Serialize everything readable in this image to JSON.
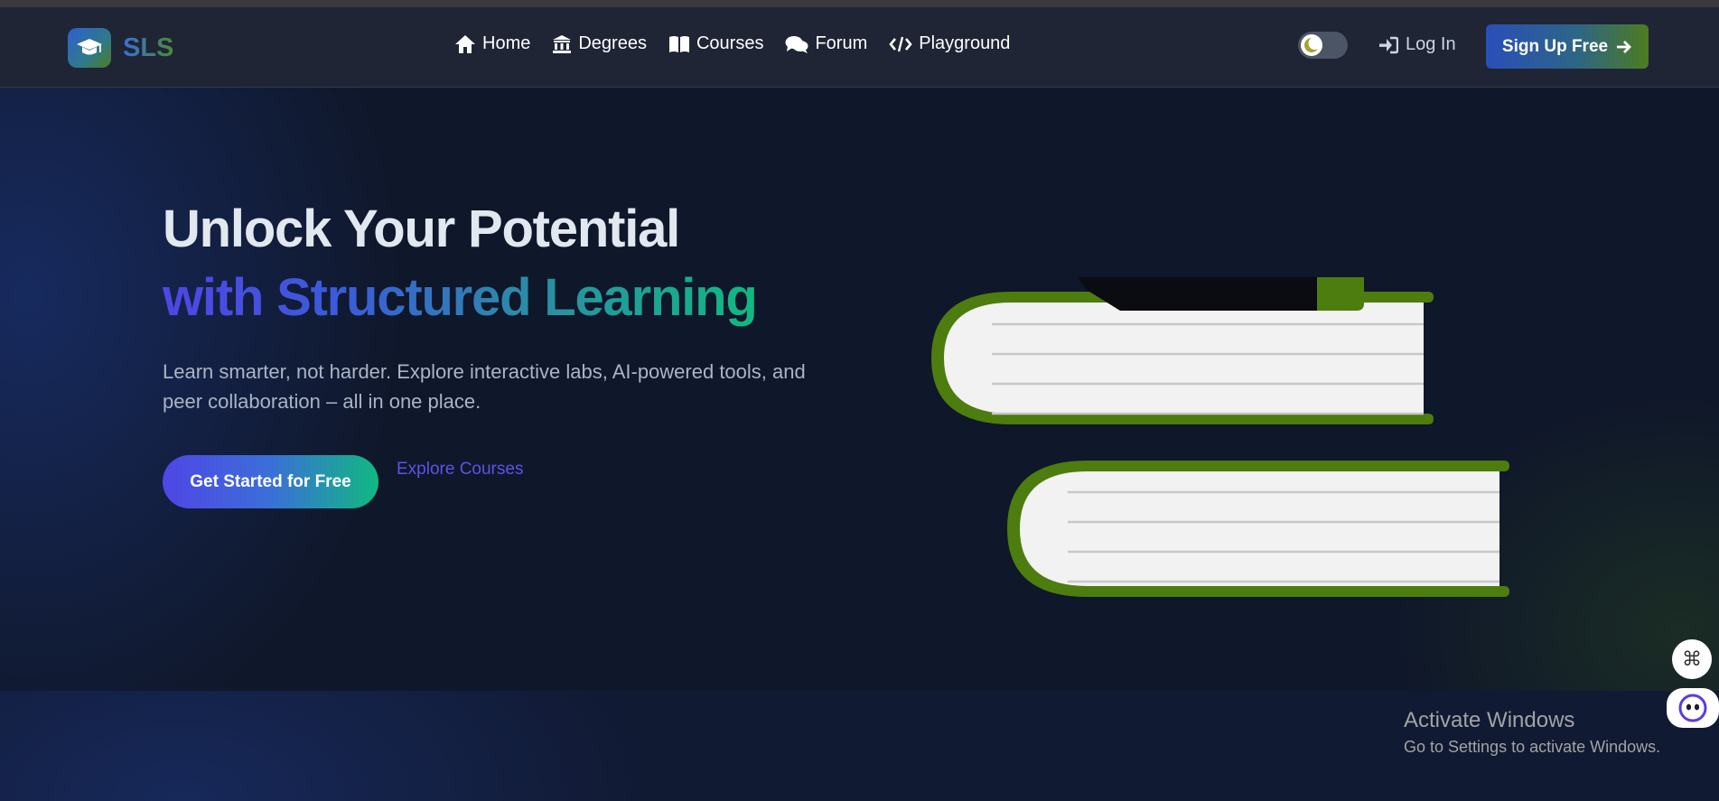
{
  "navbar": {
    "logo_text": "SLS",
    "links": [
      {
        "label": "Home",
        "icon": "home-icon"
      },
      {
        "label": "Degrees",
        "icon": "university-icon"
      },
      {
        "label": "Courses",
        "icon": "book-open-icon"
      },
      {
        "label": "Forum",
        "icon": "comments-icon"
      },
      {
        "label": "Playground",
        "icon": "code-icon"
      }
    ],
    "theme_toggle_icon": "moon-icon",
    "login_label": "Log In",
    "signup_label": "Sign Up Free"
  },
  "hero": {
    "title_line1": "Unlock Your Potential",
    "title_line2": "with Structured Learning",
    "description": "Learn smarter, not harder. Explore interactive labs, AI-powered tools, and peer collaboration – all in one place.",
    "cta_label": "Get Started for Free",
    "explore_label": "Explore Courses",
    "illustration": "stacked-books-illustration"
  },
  "watermark": {
    "title": "Activate Windows",
    "subtitle": "Go to Settings to activate Windows."
  },
  "colors": {
    "background": "#0f172a",
    "navbar": "#1f2535",
    "accent_indigo": "#4f46e5",
    "accent_green": "#10b981",
    "book_green": "#4d7c0f"
  }
}
